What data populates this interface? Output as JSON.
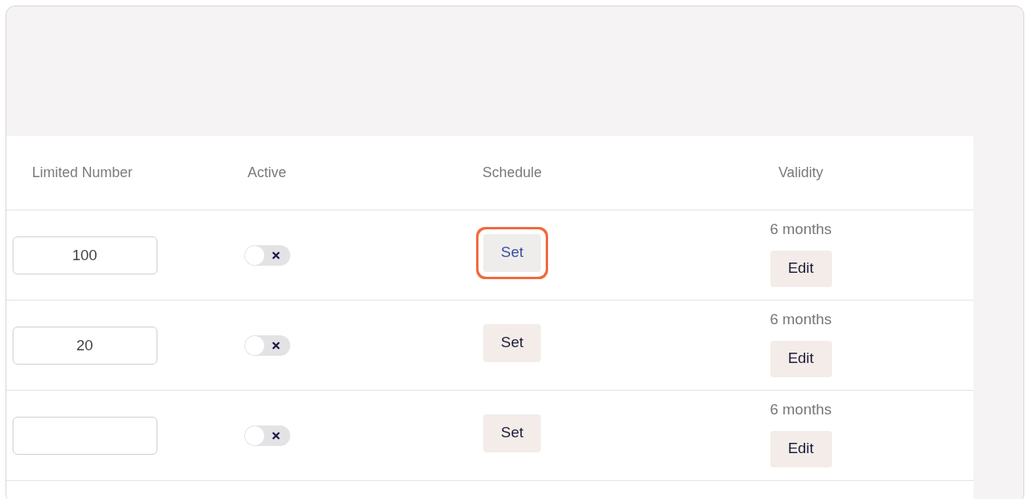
{
  "table": {
    "columns": [
      "Limited Number",
      "Active",
      "Schedule",
      "Validity"
    ],
    "rows": [
      {
        "limited_number": "100",
        "active": false,
        "schedule_button": "Set",
        "schedule_focused": true,
        "validity": "6 months",
        "edit_button": "Edit"
      },
      {
        "limited_number": "20",
        "active": false,
        "schedule_button": "Set",
        "schedule_focused": false,
        "validity": "6 months",
        "edit_button": "Edit"
      },
      {
        "limited_number": "",
        "active": false,
        "schedule_button": "Set",
        "schedule_focused": false,
        "validity": "6 months",
        "edit_button": "Edit"
      }
    ]
  }
}
